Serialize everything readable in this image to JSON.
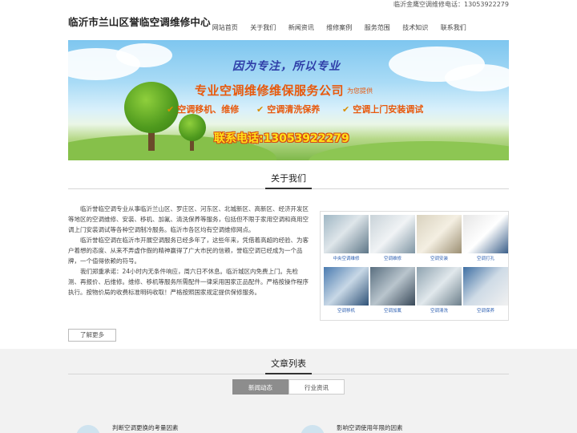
{
  "topbar": {
    "contact": "临沂金鹰空调维修电话：13053922279"
  },
  "header": {
    "site_title": "临沂市兰山区誉临空调维修中心",
    "nav": [
      "网站首页",
      "关于我们",
      "新闻资讯",
      "维修案例",
      "服务范围",
      "技术知识",
      "联系我们"
    ]
  },
  "banner": {
    "slogan": "因为专注，所以专业",
    "headline": "专业空调维修维保服务公司",
    "headline_sub": "为您提供",
    "services": [
      "空调移机、维修",
      "空调清洗保养",
      "空调上门安装调试"
    ],
    "phone": "联系电话:13053922279"
  },
  "about": {
    "title": "关于我们",
    "paragraphs": [
      "临沂誉临空调专业从事临沂兰山区、罗庄区、河东区、北城新区、高新区、经济开发区等地区的空调维修、安装、移机、加氟、清洗保养等服务，包括但不限于家用空调和商用空调上门安装调试等各种空调制冷服务。临沂市各区均有空调维修网点。",
      "临沂誉临空调在临沂市开展空调服务已经多年了，这些年来，凭借着高超的经验、为客户着想的态度、从来不弄虚作假的精神赢得了广大市民的信赖，誉临空调已经成为一个品牌，一个值得依赖的符号。",
      "我们郑重承诺：24小时内无条件响应，周六日不休息。临沂城区内免费上门。先检测、再报价、后维修。维修、移机等服务所需配件一律采用国家正品配件。严格按操作程序执行。按物价局的收费标准明码收取！严格按照国家规定提供保修服务。"
    ],
    "more_label": "了解更多",
    "photo_captions": [
      "中央空调维修",
      "空调维修",
      "空调安装",
      "空调打孔",
      "空调移机",
      "空调加氟",
      "空调清洗",
      "空调保养"
    ]
  },
  "articles": {
    "title": "文章列表",
    "tabs": [
      "新闻动态",
      "行业资讯"
    ],
    "items": [
      "判断空调更换的考量因素",
      "影响空调使用年限的因素"
    ]
  },
  "colors": {
    "accent_orange": "#e8590c",
    "tab_active": "#8d8d8d",
    "caption_blue": "#2a5db0"
  }
}
